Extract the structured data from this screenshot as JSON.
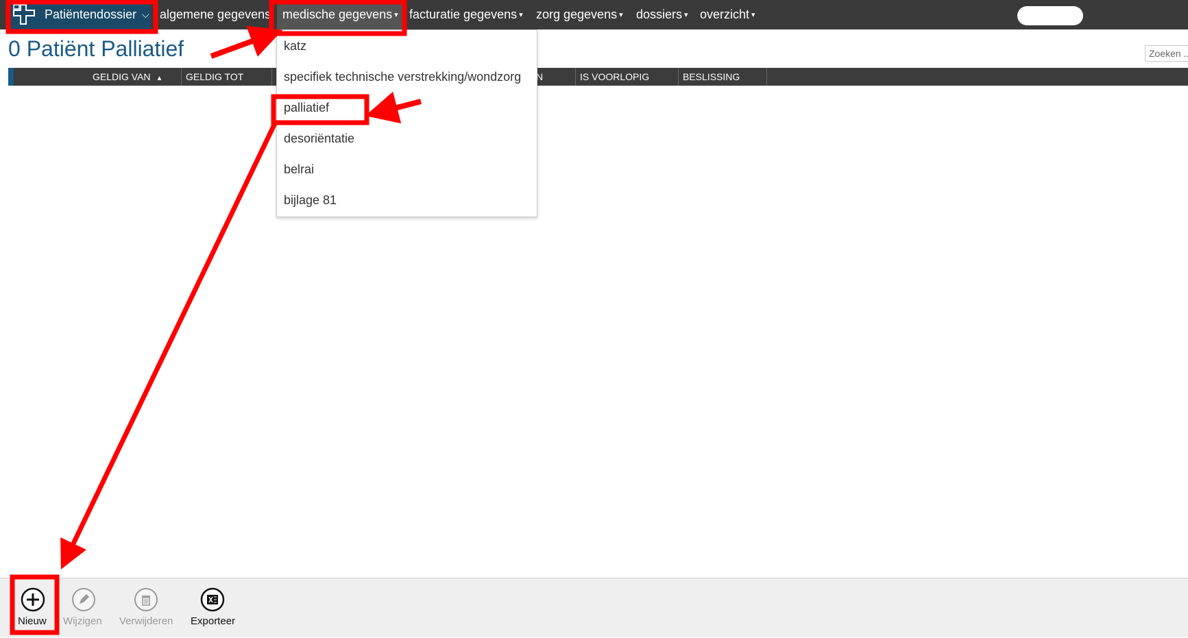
{
  "nav": {
    "brand_label": "Patiëntendossier",
    "items": [
      {
        "label": "algemene gegevens",
        "has_caret": false
      },
      {
        "label": "medische gegevens",
        "has_caret": true,
        "active": true
      },
      {
        "label": "facturatie gegevens",
        "has_caret": true
      },
      {
        "label": "zorg gegevens",
        "has_caret": true
      },
      {
        "label": "dossiers",
        "has_caret": true
      },
      {
        "label": "overzicht",
        "has_caret": true
      }
    ],
    "caret_glyph": "▾",
    "brand_chevron": "⌄"
  },
  "page": {
    "title": "0 Patiënt Palliatief",
    "search_placeholder": "Zoeken ..."
  },
  "table": {
    "columns": [
      {
        "label": "GELDIG VAN",
        "sort": "asc"
      },
      {
        "label": "GELDIG TOT"
      },
      {
        "label": "N"
      },
      {
        "label": "IS VOORLOPIG"
      },
      {
        "label": "BESLISSING"
      }
    ],
    "sort_glyph": "▲"
  },
  "dropdown": {
    "items": [
      "katz",
      "specifiek technische verstrekking/wondzorg",
      "palliatief",
      "desoriëntatie",
      "belrai",
      "bijlage 81"
    ]
  },
  "toolbar": {
    "items": [
      {
        "label": "Nieuw",
        "icon": "plus-circle-icon",
        "enabled": true
      },
      {
        "label": "Wijzigen",
        "icon": "pencil-circle-icon",
        "enabled": false
      },
      {
        "label": "Verwijderen",
        "icon": "trash-circle-icon",
        "enabled": false
      },
      {
        "label": "Exporteer",
        "icon": "excel-circle-icon",
        "enabled": true
      }
    ]
  },
  "colors": {
    "topbar": "#3a3a3a",
    "brand": "#1a4a68",
    "title": "#1a5a85",
    "annotation": "#ff0000"
  }
}
